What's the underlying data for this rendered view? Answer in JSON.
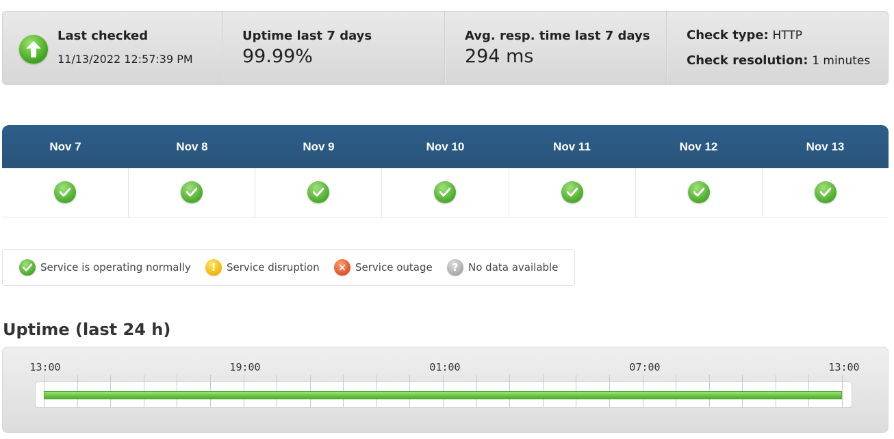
{
  "summary": {
    "last_checked_label": "Last checked",
    "last_checked_value": "11/13/2022 12:57:39 PM",
    "uptime_label": "Uptime last 7 days",
    "uptime_value": "99.99%",
    "resp_label": "Avg. resp. time last 7 days",
    "resp_value": "294 ms",
    "check_type_label": "Check type:",
    "check_type_value": "HTTP",
    "check_resolution_label": "Check resolution:",
    "check_resolution_value": "1 minutes",
    "status_icon": "arrow-up-icon"
  },
  "days": [
    {
      "label": "Nov 7",
      "status": "ok"
    },
    {
      "label": "Nov 8",
      "status": "ok"
    },
    {
      "label": "Nov 9",
      "status": "ok"
    },
    {
      "label": "Nov 10",
      "status": "ok"
    },
    {
      "label": "Nov 11",
      "status": "ok"
    },
    {
      "label": "Nov 12",
      "status": "ok"
    },
    {
      "label": "Nov 13",
      "status": "ok"
    }
  ],
  "legend": [
    {
      "label": "Service is operating normally",
      "icon": "check-icon"
    },
    {
      "label": "Service disruption",
      "icon": "warning-icon"
    },
    {
      "label": "Service outage",
      "icon": "x-icon"
    },
    {
      "label": "No data available",
      "icon": "question-icon"
    }
  ],
  "uptime24": {
    "title": "Uptime (last 24 h)",
    "tick_labels": [
      "13:00",
      "19:00",
      "01:00",
      "07:00",
      "13:00"
    ],
    "status": "up",
    "uptime_fraction": 1.0
  },
  "colors": {
    "header_blue": "#2c5e8a",
    "ok_green": "#4aab2a",
    "warn_yellow": "#f2b705",
    "err_orange": "#e0532a",
    "na_gray": "#a9a9a9"
  }
}
